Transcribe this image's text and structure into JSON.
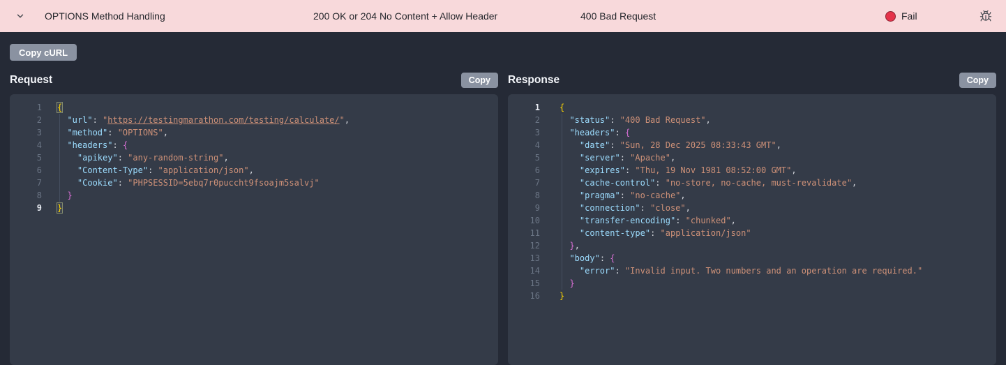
{
  "topbar": {
    "test_name": "OPTIONS Method Handling",
    "expected": "200 OK or 204 No Content + Allow Header",
    "actual": "400 Bad Request",
    "status_label": "Fail",
    "status_color": "#e5334a",
    "topbar_bg": "#f8d9db"
  },
  "toolbar": {
    "copy_curl_label": "Copy cURL"
  },
  "request_panel": {
    "title": "Request",
    "copy_label": "Copy",
    "active_line": 9,
    "indent_guides": [
      [
        0,
        2,
        8
      ]
    ],
    "lines": [
      [
        [
          "b1m",
          "{"
        ]
      ],
      [
        [
          "p",
          "  "
        ],
        [
          "k",
          "\"url\""
        ],
        [
          "p",
          ": "
        ],
        [
          "s",
          "\""
        ],
        [
          "l",
          "https://testingmarathon.com/testing/calculate/"
        ],
        [
          "s",
          "\""
        ],
        [
          "p",
          ","
        ]
      ],
      [
        [
          "p",
          "  "
        ],
        [
          "k",
          "\"method\""
        ],
        [
          "p",
          ": "
        ],
        [
          "s",
          "\"OPTIONS\""
        ],
        [
          "p",
          ","
        ]
      ],
      [
        [
          "p",
          "  "
        ],
        [
          "k",
          "\"headers\""
        ],
        [
          "p",
          ": "
        ],
        [
          "b2",
          "{"
        ]
      ],
      [
        [
          "p",
          "    "
        ],
        [
          "k",
          "\"apikey\""
        ],
        [
          "p",
          ": "
        ],
        [
          "s",
          "\"any-random-string\""
        ],
        [
          "p",
          ","
        ]
      ],
      [
        [
          "p",
          "    "
        ],
        [
          "k",
          "\"Content-Type\""
        ],
        [
          "p",
          ": "
        ],
        [
          "s",
          "\"application/json\""
        ],
        [
          "p",
          ","
        ]
      ],
      [
        [
          "p",
          "    "
        ],
        [
          "k",
          "\"Cookie\""
        ],
        [
          "p",
          ": "
        ],
        [
          "s",
          "\"PHPSESSID=5ebq7r0puccht9fsoajm5salvj\""
        ]
      ],
      [
        [
          "p",
          "  "
        ],
        [
          "b2",
          "}"
        ]
      ],
      [
        [
          "b1m",
          "}"
        ]
      ]
    ]
  },
  "response_panel": {
    "title": "Response",
    "copy_label": "Copy",
    "active_line": 1,
    "indent_guides": [
      [
        0,
        2,
        15
      ]
    ],
    "lines": [
      [
        [
          "b1",
          "{"
        ]
      ],
      [
        [
          "p",
          "  "
        ],
        [
          "k",
          "\"status\""
        ],
        [
          "p",
          ": "
        ],
        [
          "s",
          "\"400 Bad Request\""
        ],
        [
          "p",
          ","
        ]
      ],
      [
        [
          "p",
          "  "
        ],
        [
          "k",
          "\"headers\""
        ],
        [
          "p",
          ": "
        ],
        [
          "b2",
          "{"
        ]
      ],
      [
        [
          "p",
          "    "
        ],
        [
          "k",
          "\"date\""
        ],
        [
          "p",
          ": "
        ],
        [
          "s",
          "\"Sun, 28 Dec 2025 08:33:43 GMT\""
        ],
        [
          "p",
          ","
        ]
      ],
      [
        [
          "p",
          "    "
        ],
        [
          "k",
          "\"server\""
        ],
        [
          "p",
          ": "
        ],
        [
          "s",
          "\"Apache\""
        ],
        [
          "p",
          ","
        ]
      ],
      [
        [
          "p",
          "    "
        ],
        [
          "k",
          "\"expires\""
        ],
        [
          "p",
          ": "
        ],
        [
          "s",
          "\"Thu, 19 Nov 1981 08:52:00 GMT\""
        ],
        [
          "p",
          ","
        ]
      ],
      [
        [
          "p",
          "    "
        ],
        [
          "k",
          "\"cache-control\""
        ],
        [
          "p",
          ": "
        ],
        [
          "s",
          "\"no-store, no-cache, must-revalidate\""
        ],
        [
          "p",
          ","
        ]
      ],
      [
        [
          "p",
          "    "
        ],
        [
          "k",
          "\"pragma\""
        ],
        [
          "p",
          ": "
        ],
        [
          "s",
          "\"no-cache\""
        ],
        [
          "p",
          ","
        ]
      ],
      [
        [
          "p",
          "    "
        ],
        [
          "k",
          "\"connection\""
        ],
        [
          "p",
          ": "
        ],
        [
          "s",
          "\"close\""
        ],
        [
          "p",
          ","
        ]
      ],
      [
        [
          "p",
          "    "
        ],
        [
          "k",
          "\"transfer-encoding\""
        ],
        [
          "p",
          ": "
        ],
        [
          "s",
          "\"chunked\""
        ],
        [
          "p",
          ","
        ]
      ],
      [
        [
          "p",
          "    "
        ],
        [
          "k",
          "\"content-type\""
        ],
        [
          "p",
          ": "
        ],
        [
          "s",
          "\"application/json\""
        ]
      ],
      [
        [
          "p",
          "  "
        ],
        [
          "b2",
          "}"
        ],
        [
          "p",
          ","
        ]
      ],
      [
        [
          "p",
          "  "
        ],
        [
          "k",
          "\"body\""
        ],
        [
          "p",
          ": "
        ],
        [
          "b2",
          "{"
        ]
      ],
      [
        [
          "p",
          "    "
        ],
        [
          "k",
          "\"error\""
        ],
        [
          "p",
          ": "
        ],
        [
          "s",
          "\"Invalid input. Two numbers and an operation are required.\""
        ]
      ],
      [
        [
          "p",
          "  "
        ],
        [
          "b2",
          "}"
        ]
      ],
      [
        [
          "b1",
          "}"
        ]
      ]
    ]
  }
}
